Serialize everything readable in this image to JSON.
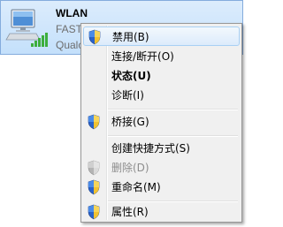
{
  "adapter": {
    "name": "WLAN",
    "network": "FAST",
    "device": "Qualc",
    "icon": "wireless-network-adapter-icon"
  },
  "menu": {
    "items": [
      {
        "label": "禁用(B)",
        "icon": "uac-shield-icon",
        "highlighted": true
      },
      {
        "label": "连接/断开(O)"
      },
      {
        "label": "状态(U)",
        "bold": true
      },
      {
        "label": "诊断(I)"
      },
      {
        "label": "桥接(G)",
        "icon": "uac-shield-icon"
      },
      {
        "label": "创建快捷方式(S)"
      },
      {
        "label": "删除(D)",
        "icon": "uac-shield-icon",
        "disabled": true
      },
      {
        "label": "重命名(M)",
        "icon": "uac-shield-icon"
      },
      {
        "label": "属性(R)",
        "icon": "uac-shield-icon"
      }
    ]
  },
  "colors": {
    "selection_bg": "#c4e0fb",
    "selection_border": "#84acdd",
    "menu_bg": "#f0f0f0",
    "highlight_border": "#a8d0f4",
    "signal_green": "#3cae3c"
  }
}
